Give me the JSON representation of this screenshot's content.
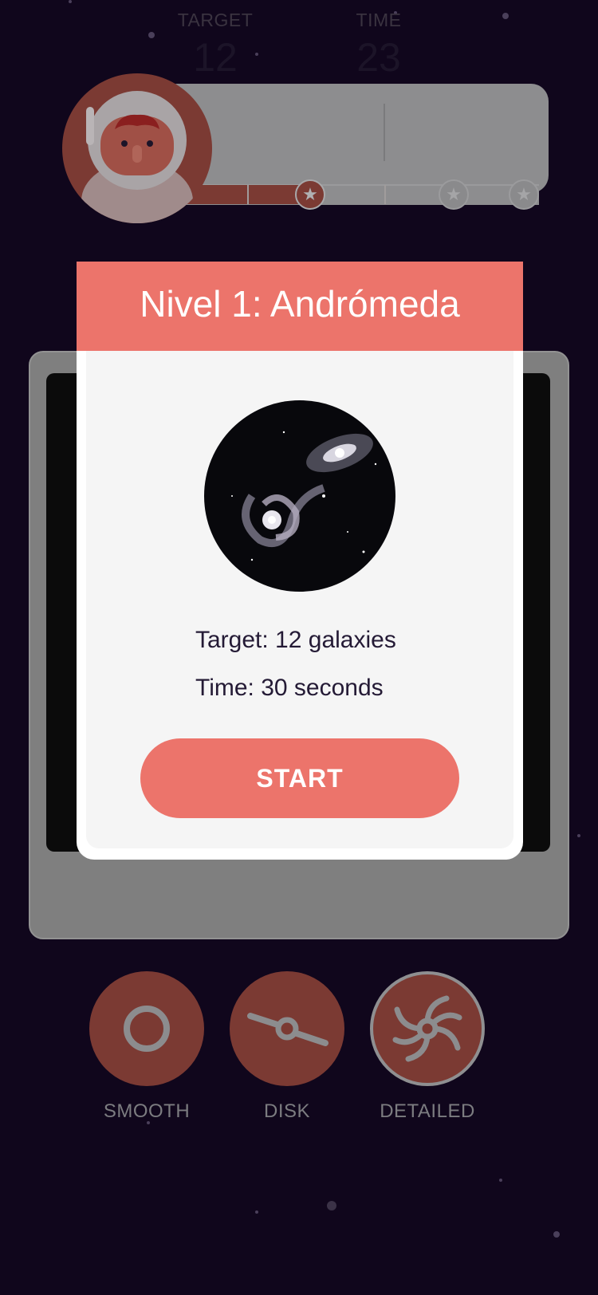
{
  "hud": {
    "target_label": "TARGET",
    "target_value": "12",
    "time_label": "TIME",
    "time_value": "23"
  },
  "modal": {
    "title": "Nivel 1: Andrómeda",
    "target_text": "Target: 12 galaxies",
    "time_text": "Time: 30 seconds",
    "start_label": "START"
  },
  "categories": [
    {
      "label": "SMOOTH",
      "icon": "smooth-circle-icon"
    },
    {
      "label": "DISK",
      "icon": "disk-icon"
    },
    {
      "label": "DETAILED",
      "icon": "spiral-galaxy-icon"
    }
  ],
  "colors": {
    "background": "#10061c",
    "accent": "#ec746b",
    "dim_accent": "#7b3a33"
  }
}
